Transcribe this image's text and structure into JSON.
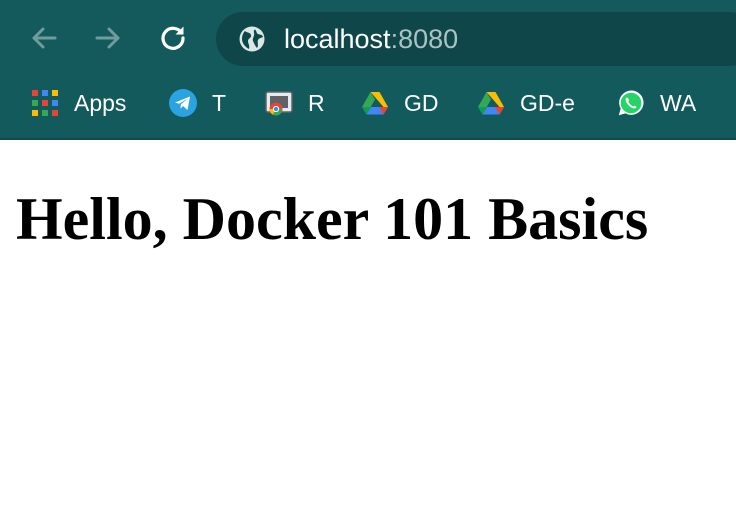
{
  "colors": {
    "toolbar_bg": "#145a5c",
    "omnibox_bg": "#0e4649",
    "port_text": "#a9c3c4",
    "page_bg": "#ffffff"
  },
  "toolbar": {
    "back_icon": "arrow-left-icon",
    "forward_icon": "arrow-right-icon",
    "reload_icon": "reload-icon"
  },
  "address_bar": {
    "site_icon": "globe-icon",
    "host": "localhost",
    "port": ":8080"
  },
  "bookmarks": [
    {
      "label": "Apps",
      "icon": "apps-grid-icon"
    },
    {
      "label": "T",
      "icon": "telegram-icon"
    },
    {
      "label": "R",
      "icon": "chrome-remote-icon"
    },
    {
      "label": "GD",
      "icon": "google-drive-icon"
    },
    {
      "label": "GD-e",
      "icon": "google-drive-icon"
    },
    {
      "label": "WA",
      "icon": "whatsapp-icon"
    }
  ],
  "page": {
    "heading": "Hello, Docker 101 Basics"
  }
}
